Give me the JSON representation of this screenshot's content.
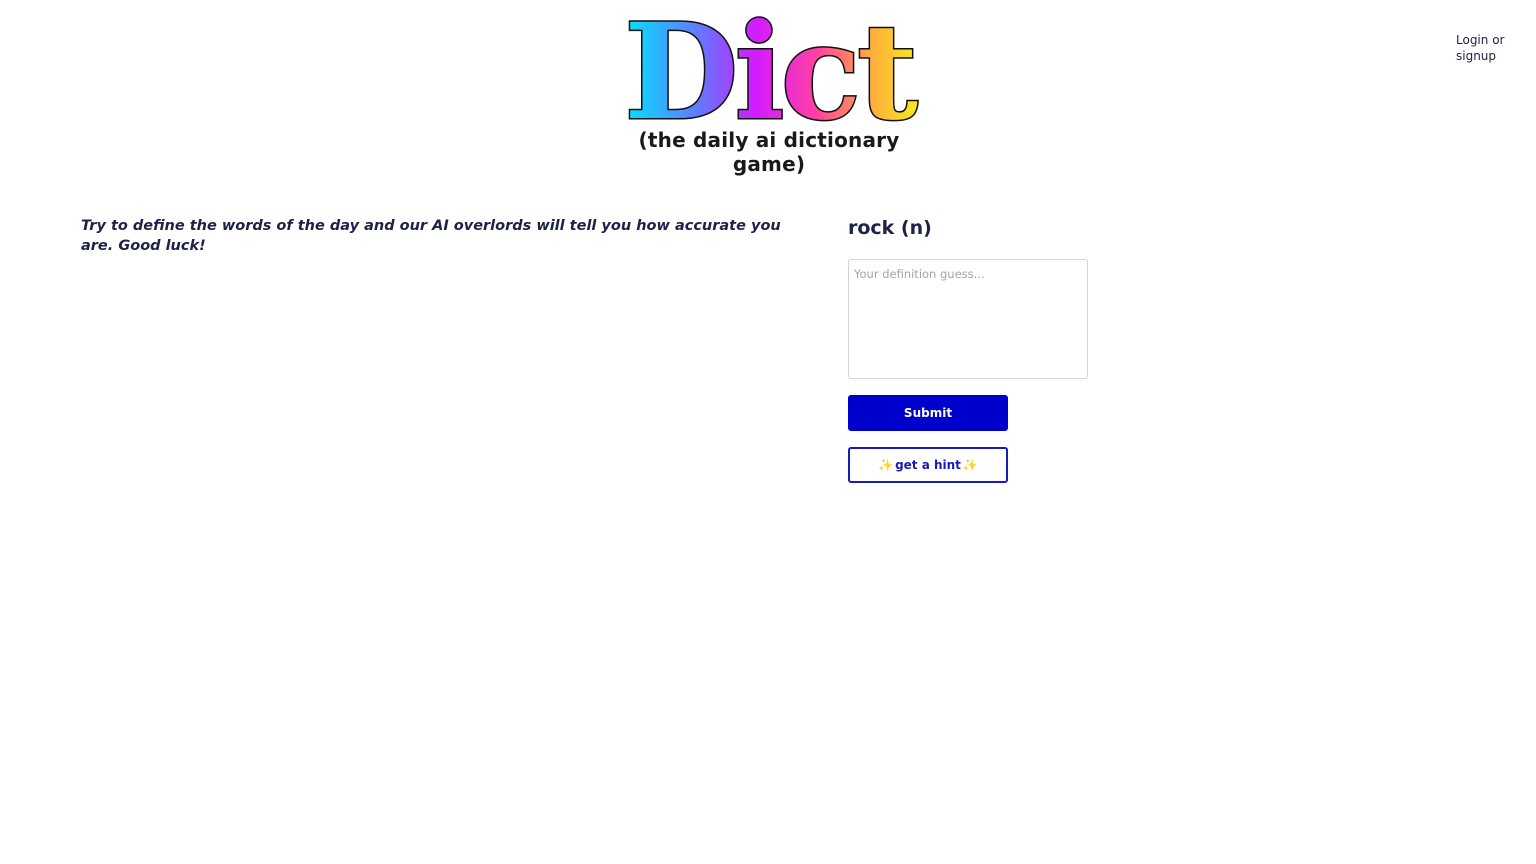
{
  "header": {
    "logo_text": "Dict",
    "tagline": "(the daily ai dictionary game)",
    "login_label": "Login or signup"
  },
  "intro": {
    "text": "Try to define the words of the day and our AI overlords will tell you how accurate you are. Good luck!"
  },
  "game": {
    "word": "rock (n)",
    "guess_placeholder": "Your definition guess...",
    "guess_value": "",
    "submit_label": "Submit",
    "hint_label": "get a hint",
    "hint_icon": "sparkles-icon"
  },
  "colors": {
    "logo_gradient": [
      "#00e5ff",
      "#7b61ff",
      "#d41bff",
      "#ff3fa4",
      "#ffb13b",
      "#f6ea20"
    ],
    "primary_button": "#0000cc",
    "text": "#1e2148"
  }
}
